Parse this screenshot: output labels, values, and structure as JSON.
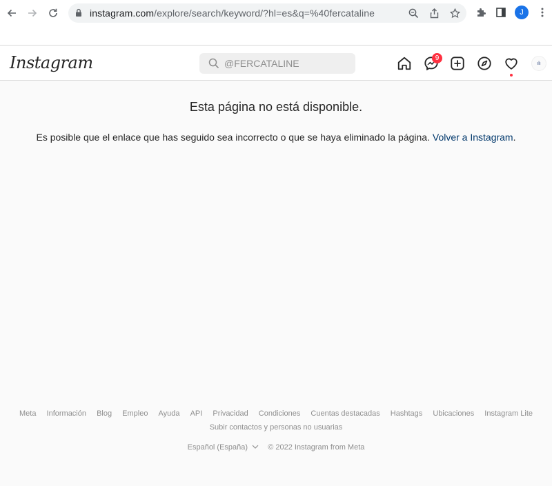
{
  "browser": {
    "url_host": "instagram.com",
    "url_path": "/explore/search/keyword/?hl=es&q=%40fercataline",
    "profile_initial": "J"
  },
  "header": {
    "logo": "Instagram",
    "search_placeholder": "@FERCATALINE",
    "messenger_badge": "9",
    "profile_pic_label": "ılı"
  },
  "main": {
    "title": "Esta página no está disponible.",
    "body": "Es posible que el enlace que has seguido sea incorrecto o que se haya eliminado la página. ",
    "link": "Volver a Instagram",
    "period": "."
  },
  "footer": {
    "links": [
      "Meta",
      "Información",
      "Blog",
      "Empleo",
      "Ayuda",
      "API",
      "Privacidad",
      "Condiciones",
      "Cuentas destacadas",
      "Hashtags",
      "Ubicaciones",
      "Instagram Lite"
    ],
    "link_second_line": "Subir contactos y personas no usuarias",
    "language": "Español (España)",
    "copyright": "© 2022 Instagram from Meta"
  }
}
